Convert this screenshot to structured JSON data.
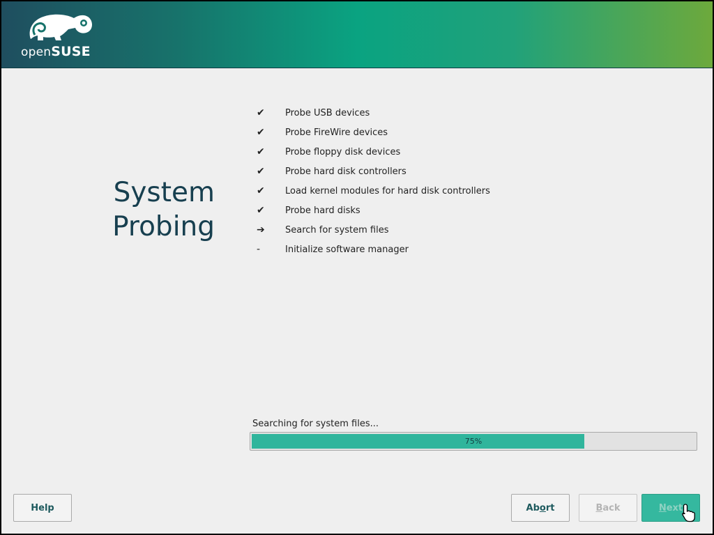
{
  "header": {
    "logo_prefix": "open",
    "logo_suffix": "SUSE",
    "gradient": [
      "#1f4e5f",
      "#0aa381",
      "#6da93c"
    ]
  },
  "title": {
    "line1": "System",
    "line2": "Probing"
  },
  "steps": [
    {
      "icon": "✔",
      "status": "done",
      "label": "Probe USB devices"
    },
    {
      "icon": "✔",
      "status": "done",
      "label": "Probe FireWire devices"
    },
    {
      "icon": "✔",
      "status": "done",
      "label": "Probe floppy disk devices"
    },
    {
      "icon": "✔",
      "status": "done",
      "label": "Probe hard disk controllers"
    },
    {
      "icon": "✔",
      "status": "done",
      "label": "Load kernel modules for hard disk controllers"
    },
    {
      "icon": "✔",
      "status": "done",
      "label": "Probe hard disks"
    },
    {
      "icon": "➔",
      "status": "current",
      "label": "Search for system files"
    },
    {
      "icon": "-",
      "status": "pending",
      "label": "Initialize software manager"
    }
  ],
  "progress": {
    "label": "Searching for system files...",
    "value_text": "75%",
    "value": 0.75,
    "color": "#30b59c"
  },
  "buttons": {
    "help": "Help",
    "abort_pre": "Ab",
    "abort_u": "o",
    "abort_post": "rt",
    "back_u": "B",
    "back_post": "ack",
    "next_u": "N",
    "next_post": "ext"
  }
}
